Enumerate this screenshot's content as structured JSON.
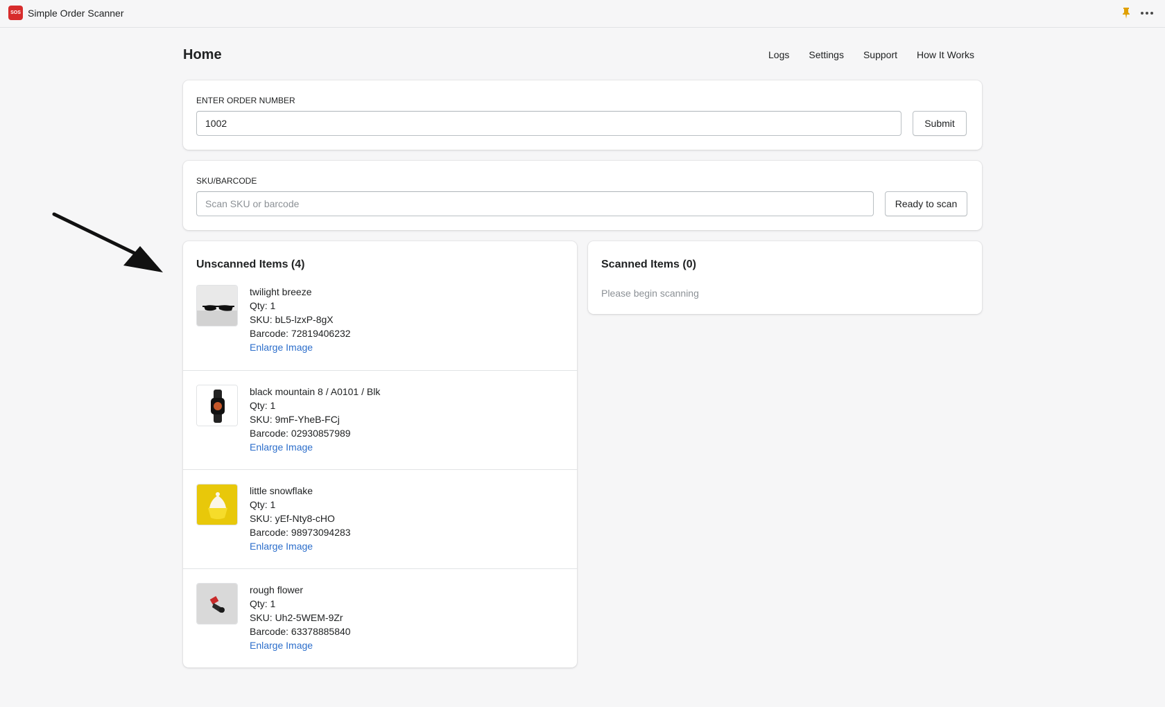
{
  "app": {
    "title": "Simple Order Scanner",
    "logo_text": "SOS"
  },
  "header": {
    "title": "Home",
    "nav": [
      "Logs",
      "Settings",
      "Support",
      "How It Works"
    ]
  },
  "order": {
    "label": "ENTER ORDER NUMBER",
    "value": "1002",
    "submit": "Submit"
  },
  "scan": {
    "label": "SKU/BARCODE",
    "placeholder": "Scan SKU or barcode",
    "status_button": "Ready to scan"
  },
  "unscanned": {
    "title": "Unscanned Items (4)",
    "items": [
      {
        "name": "twilight breeze",
        "qty": "Qty: 1",
        "sku": "SKU: bL5-lzxP-8gX",
        "barcode": "Barcode: 72819406232",
        "link": "Enlarge Image",
        "image": "sunglasses-image"
      },
      {
        "name": "black mountain 8 / A0101 / Blk",
        "qty": "Qty: 1",
        "sku": "SKU: 9mF-YheB-FCj",
        "barcode": "Barcode: 02930857989",
        "link": "Enlarge Image",
        "image": "smartwatch-image"
      },
      {
        "name": "little snowflake",
        "qty": "Qty: 1",
        "sku": "SKU: yEf-Nty8-cHO",
        "barcode": "Barcode: 98973094283",
        "link": "Enlarge Image",
        "image": "cupcake-image"
      },
      {
        "name": "rough flower",
        "qty": "Qty: 1",
        "sku": "SKU: Uh2-5WEM-9Zr",
        "barcode": "Barcode: 63378885840",
        "link": "Enlarge Image",
        "image": "gadget-image"
      }
    ]
  },
  "scanned": {
    "title": "Scanned Items (0)",
    "empty_text": "Please begin scanning"
  },
  "colors": {
    "accent": "#d72c2c",
    "link": "#2c6ecb",
    "pin": "#e0a000"
  }
}
